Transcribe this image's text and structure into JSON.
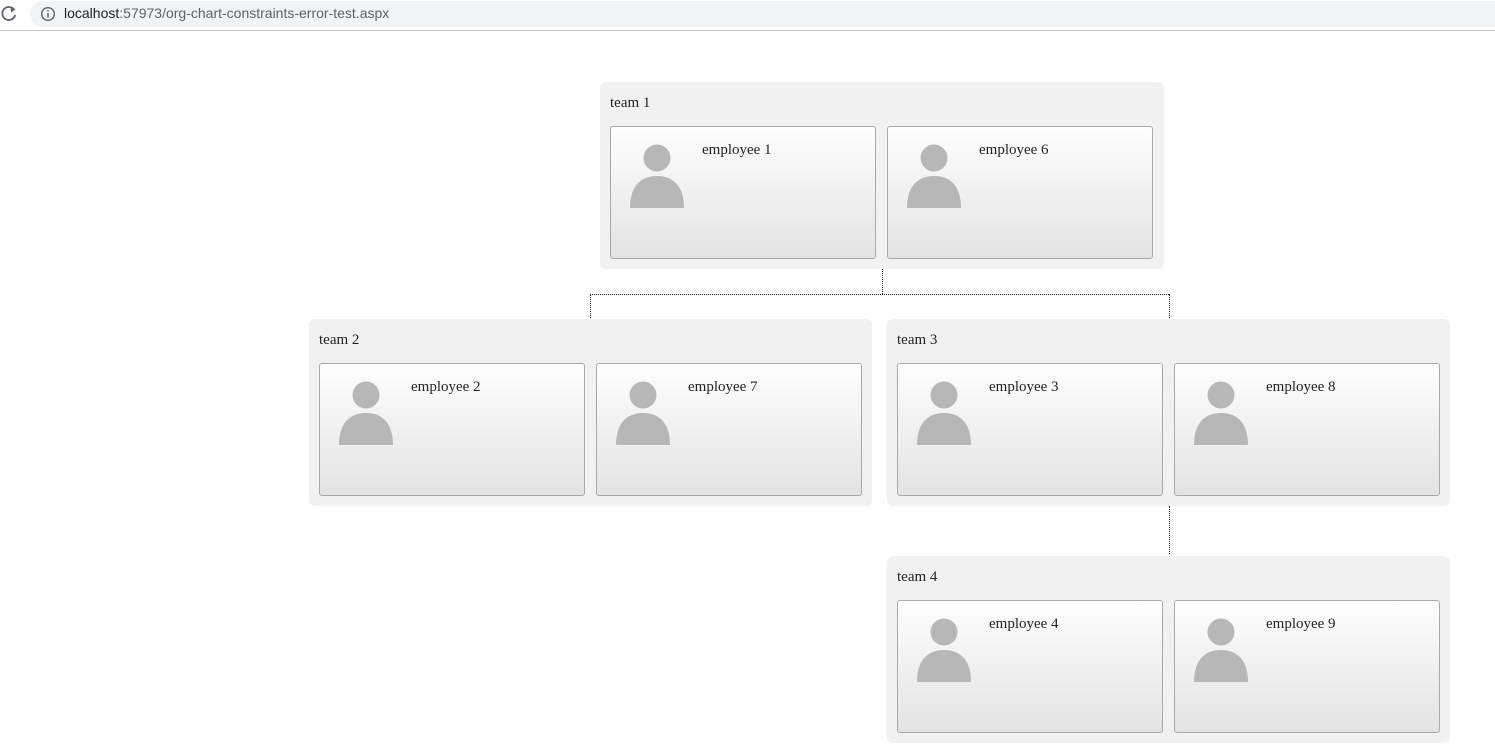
{
  "browser": {
    "url_host": "localhost",
    "url_rest": ":57973/org-chart-constraints-error-test.aspx"
  },
  "icons": {
    "reload": "reload-icon",
    "info": "info-icon",
    "person": "person-icon"
  },
  "colors": {
    "team_bg": "#f1f1f1",
    "avatar": "#b7b7b7",
    "card_border": "#a9a9a9"
  },
  "teams": [
    {
      "label": "team 1",
      "employees": [
        "employee 1",
        "employee 6"
      ]
    },
    {
      "label": "team 2",
      "employees": [
        "employee 2",
        "employee 7"
      ]
    },
    {
      "label": "team 3",
      "employees": [
        "employee 3",
        "employee 8"
      ]
    },
    {
      "label": "team 4",
      "employees": [
        "employee 4",
        "employee 9"
      ]
    }
  ]
}
